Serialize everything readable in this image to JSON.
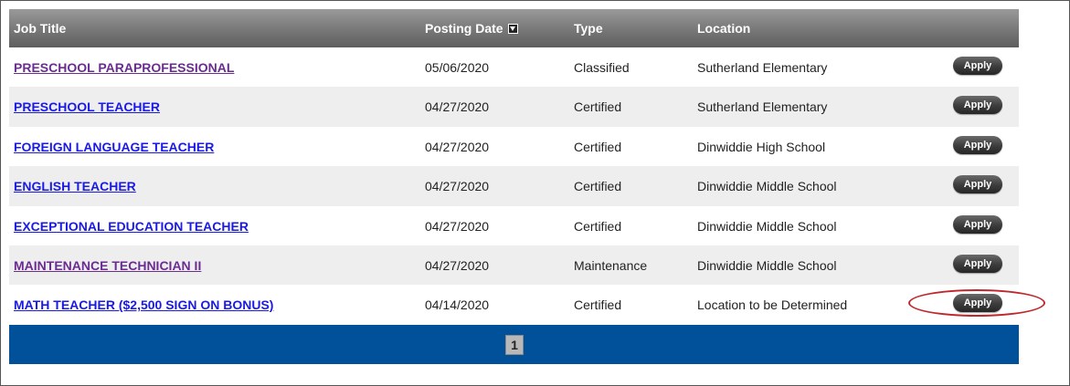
{
  "header": {
    "job_title": "Job Title",
    "posting_date": "Posting Date",
    "type": "Type",
    "location": "Location"
  },
  "rows": [
    {
      "title": "PRESCHOOL PARAPROFESSIONAL",
      "date": "05/06/2020",
      "type": "Classified",
      "location": "Sutherland Elementary",
      "apply": "Apply",
      "visited": true
    },
    {
      "title": "PRESCHOOL TEACHER",
      "date": "04/27/2020",
      "type": "Certified",
      "location": "Sutherland Elementary",
      "apply": "Apply",
      "visited": false
    },
    {
      "title": "FOREIGN LANGUAGE TEACHER",
      "date": "04/27/2020",
      "type": "Certified",
      "location": "Dinwiddie High School",
      "apply": "Apply",
      "visited": false
    },
    {
      "title": "ENGLISH TEACHER",
      "date": "04/27/2020",
      "type": "Certified",
      "location": "Dinwiddie Middle School",
      "apply": "Apply",
      "visited": false
    },
    {
      "title": "EXCEPTIONAL EDUCATION TEACHER",
      "date": "04/27/2020",
      "type": "Certified",
      "location": "Dinwiddie Middle School",
      "apply": "Apply",
      "visited": false
    },
    {
      "title": "MAINTENANCE TECHNICIAN II",
      "date": "04/27/2020",
      "type": "Maintenance",
      "location": "Dinwiddie Middle School",
      "apply": "Apply",
      "visited": true
    },
    {
      "title": "MATH TEACHER ($2,500 SIGN ON BONUS)",
      "date": "04/14/2020",
      "type": "Certified",
      "location": "Location to be Determined",
      "apply": "Apply",
      "visited": false
    }
  ],
  "pager": {
    "current_page": "1"
  },
  "colors": {
    "visited_link": "#6a2c91",
    "link": "#1a1ae6",
    "pager_bg": "#01509a",
    "highlight": "#c0272d"
  }
}
